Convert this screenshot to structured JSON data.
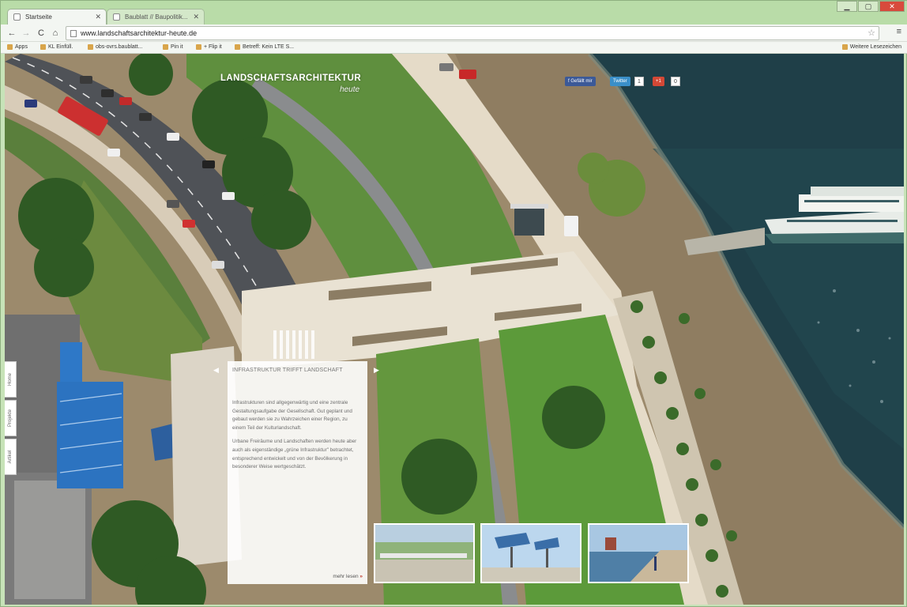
{
  "browser": {
    "tabs": [
      {
        "title": "Startseite",
        "active": true
      },
      {
        "title": "Baublatt // Baupolitik...",
        "active": false
      }
    ],
    "window_controls": {
      "minimize": "▁",
      "maximize": "▢",
      "close": "✕"
    },
    "nav": {
      "back": "←",
      "forward": "→",
      "reload": "C",
      "home": "⌂"
    },
    "address": "www.landschaftsarchitektur-heute.de",
    "bookmarks": [
      "Apps",
      "KL Einfüll.",
      "obs-ovrs.baublatt...",
      "Pin it",
      "+ Flip it",
      "Betreff: Kein LTE S..."
    ],
    "other_bookmarks": "Weitere Lesezeichen"
  },
  "site": {
    "logo_title": "LANDSCHAFTSARCHITEKTUR",
    "logo_sub": "heute",
    "social": {
      "facebook_label": "Gefällt mir",
      "twitter_label": "Twitter",
      "twitter_count": "1",
      "gplus_label": "+1",
      "gplus_count": "0"
    },
    "side_tabs": [
      "Home",
      "Projekte",
      "Artikel"
    ],
    "panel": {
      "title": "INFRASTRUKTUR TRIFFT LANDSCHAFT",
      "paragraph1": "Infrastrukturen sind allgegenwärtig und eine zentrale Gestaltungsaufgabe der Gesellschaft. Gut geplant und gebaut werden sie zu Wahrzeichen einer Region, zu einem Teil der Kulturlandschaft.",
      "paragraph2": "Urbane Freiräume und Landschaften werden heute aber auch als eigenständige „grüne Infrastruktur\" betrachtet, entsprechend entwickelt und von der Bevölkerung in besonderer Weise wertgeschätzt.",
      "more_label": "mehr lesen",
      "more_arrow": "»"
    },
    "arrows": {
      "prev": "◀",
      "next": "▶"
    }
  }
}
